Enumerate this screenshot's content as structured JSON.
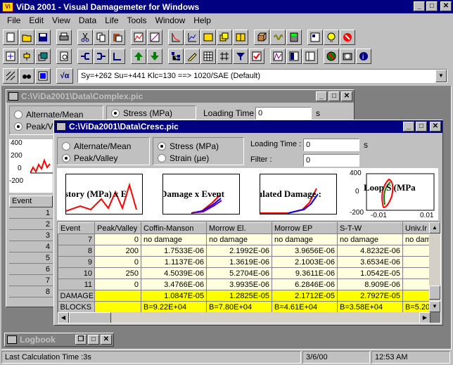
{
  "app": {
    "title": "ViDa 2001 - Visual Damagemeter for Windows",
    "icon_text": "Vi"
  },
  "window_buttons": [
    "_",
    "□",
    "✕"
  ],
  "menu": [
    "File",
    "Edit",
    "View",
    "Data",
    "Life",
    "Tools",
    "Window",
    "Help"
  ],
  "toolbar1_icons": [
    "new-icon",
    "open-icon",
    "save-icon",
    "print-icon",
    "cut-icon",
    "copy-icon",
    "paste-icon",
    "undo-icon",
    "chart-icon",
    "chart2-icon",
    "chart3-icon",
    "chart4-icon",
    "filter-icon",
    "layers-icon",
    "book-icon",
    "cube-icon",
    "wave-icon",
    "calc-icon",
    "settings-icon",
    "tip-icon",
    "info-icon"
  ],
  "toolbar2_icons": [
    "calc-icon",
    "process-icon",
    "stack-icon",
    "preview-icon",
    "split-icon",
    "merge-icon",
    "join-icon",
    "up-icon",
    "down-icon",
    "tree-icon",
    "edit-icon",
    "table-icon",
    "hash-icon",
    "funnel-icon",
    "check-icon",
    "wave2-icon",
    "ep-icon",
    "panel-icon",
    "globe-icon",
    "camera-icon",
    "help-icon"
  ],
  "toolbar3": {
    "material": "Sy=+262  Su=+441  Klc=130  ==>  1020/SAE (Default)",
    "sqrt_label": "√α"
  },
  "back_window": {
    "title": "C:\\ViDa2001\\Data\\Complex.pic",
    "opt1": "Alternate/Mean",
    "opt2": "Peak/V",
    "stress": "Stress (MPa)",
    "loading_time_label": "Loading Time :",
    "loading_time_value": "0",
    "unit": "s",
    "y_ticks": [
      "400",
      "200",
      "0",
      "-200"
    ],
    "event_header": "Event",
    "events": [
      "1",
      "2",
      "3",
      "4",
      "5",
      "6",
      "7",
      "8"
    ]
  },
  "front_window": {
    "title": "C:\\ViDa2001\\Data\\Cresc.pic",
    "opt_alt": "Alternate/Mean",
    "opt_peak": "Peak/Valley",
    "opt_stress": "Stress (MPa)",
    "opt_strain": "Strain (µe)",
    "loading_time_label": "Loading Time :",
    "loading_time_value": "0",
    "unit": "s",
    "filter_label": "Filter :",
    "filter_value": "0",
    "thumbs": [
      "story (MPa) x E",
      "Damage x Event",
      "ulated Damage :",
      "Loop S (MPa"
    ],
    "loop_ticks": {
      "y_top": "400",
      "y_mid": "0",
      "y_bot": "-200",
      "x_left": "-0.01",
      "x_right": "0.01"
    },
    "columns": [
      "Event",
      "Peak/Valley",
      "Coffin-Manson",
      "Morrow El.",
      "Morrow EP",
      "S-T-W",
      "Univ.Ir"
    ],
    "rows": [
      [
        "7",
        "0",
        "no damage",
        "no damage",
        "no damage",
        "no damage",
        "no dam"
      ],
      [
        "8",
        "200",
        "1.7533E-06",
        "2.1992E-06",
        "3.9656E-06",
        "4.8232E-06",
        ""
      ],
      [
        "9",
        "0",
        "1.1137E-06",
        "1.3619E-06",
        "2.1003E-06",
        "3.6534E-06",
        ""
      ],
      [
        "10",
        "250",
        "4.5039E-06",
        "5.2704E-06",
        "9.3611E-06",
        "1.0542E-05",
        ""
      ],
      [
        "11",
        "0",
        "3.4766E-06",
        "3.9935E-06",
        "6.2846E-06",
        "8.909E-06",
        ""
      ]
    ],
    "damage_row": [
      "DAMAGE",
      "",
      "1.0847E-05",
      "1.2825E-05",
      "2.1712E-05",
      "2.7927E-05",
      ""
    ],
    "blocks_row": [
      "BLOCKS",
      "",
      "B=9.22E+04",
      "B=7.80E+04",
      "B=4.61E+04",
      "B=3.58E+04",
      "B=5.20"
    ]
  },
  "logbook": {
    "title": "Logbook"
  },
  "status": {
    "left": "Last Calculation Time :3s",
    "date": "3/6/00",
    "time": "12:53 AM"
  },
  "colors": {
    "titlebar": "#000080",
    "face": "#c0c0c0",
    "yellow": "#ffff00",
    "cell": "#ffffe0",
    "plot_red": "#ff0000"
  }
}
